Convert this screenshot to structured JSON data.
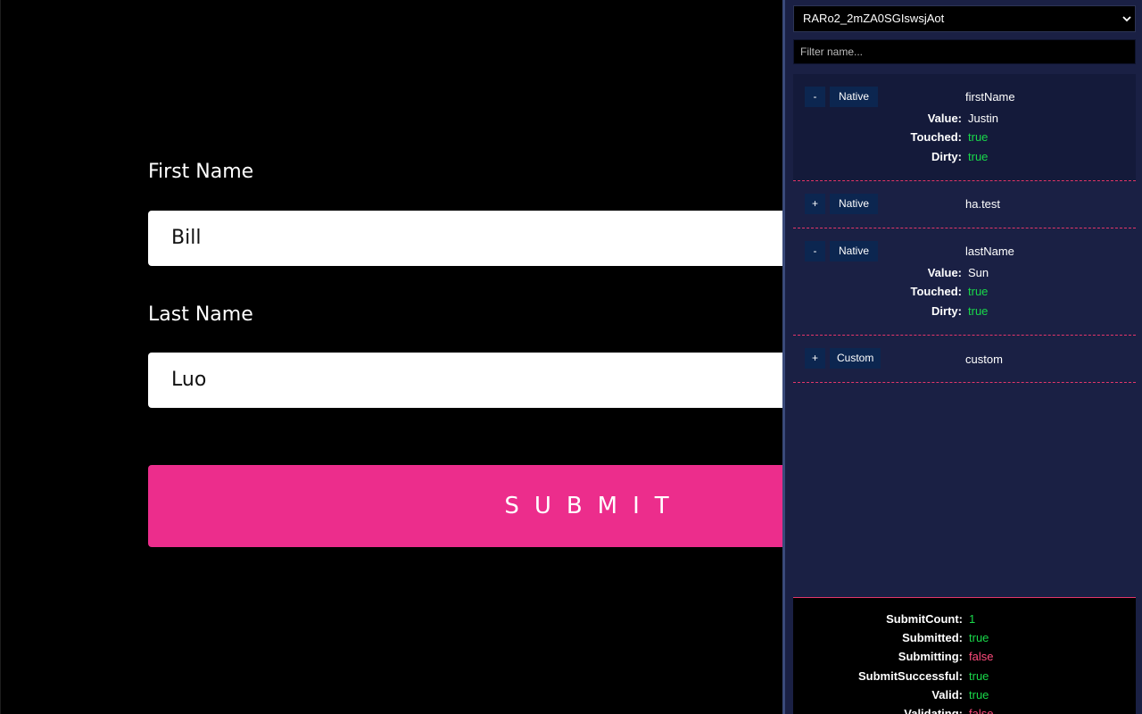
{
  "form": {
    "first_name_label": "First Name",
    "first_name_value": "Bill",
    "last_name_label": "Last Name",
    "last_name_value": "Luo",
    "submit_label": "SUBMIT",
    "accent_color": "#ec2d8c"
  },
  "devtool": {
    "form_id": "RARo2_2mZA0SGIswsjAot",
    "filter_placeholder": "Filter name...",
    "fields": [
      {
        "toggle": "-",
        "type": "Native",
        "name": "firstName",
        "value_label": "Value:",
        "value": "Justin",
        "touched_label": "Touched:",
        "touched": "true",
        "dirty_label": "Dirty:",
        "dirty": "true"
      },
      {
        "toggle": "+",
        "type": "Native",
        "name": "ha.test"
      },
      {
        "toggle": "-",
        "type": "Native",
        "name": "lastName",
        "value_label": "Value:",
        "value": "Sun",
        "touched_label": "Touched:",
        "touched": "true",
        "dirty_label": "Dirty:",
        "dirty": "true"
      },
      {
        "toggle": "+",
        "type": "Custom",
        "name": "custom"
      }
    ],
    "summary": [
      {
        "label": "SubmitCount:",
        "value": "1",
        "color": "#19d84a"
      },
      {
        "label": "Submitted:",
        "value": "true",
        "color": "#19d84a"
      },
      {
        "label": "Submitting:",
        "value": "false",
        "color": "#ff4b7c"
      },
      {
        "label": "SubmitSuccessful:",
        "value": "true",
        "color": "#19d84a"
      },
      {
        "label": "Valid:",
        "value": "true",
        "color": "#19d84a"
      },
      {
        "label": "Validating:",
        "value": "false",
        "color": "#ff4b7c"
      }
    ]
  }
}
